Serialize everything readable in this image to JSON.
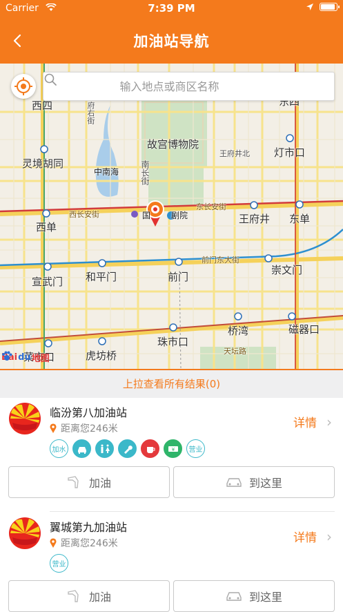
{
  "status": {
    "carrier": "Carrier",
    "time": "7:39 PM"
  },
  "nav": {
    "title": "加油站导航"
  },
  "search": {
    "placeholder": "输入地点或商区名称"
  },
  "map": {
    "labels": {
      "xisi": "西四",
      "fuyoujie": "府右街",
      "gugong": "故宫博物院",
      "dengshikou": "灯市口",
      "lingjing": "灵境胡同",
      "zhongnanhai": "中南海",
      "nanchangjie": "南长街",
      "xichanganjie": "西长安街",
      "dongchanganjie": "东长安街",
      "wangfujing": "王府井",
      "dongdan": "东单",
      "xidan": "西单",
      "guojia": "国",
      "dajuyuan": "剧院",
      "qianmendongdajie": "前门东大街",
      "xuanwumen": "宣武门",
      "hepingmen": "和平门",
      "qianmen": "前门",
      "chongwenmen": "崇文门",
      "qiaowan": "桥湾",
      "zhushikou": "珠市口",
      "cishikou": "磁器口",
      "tiantanlu": "天坛路",
      "hufangqiao": "虎坊桥",
      "caishikou": "菜市口",
      "wangfujingbei": "王府井北",
      "dongsi": "东四"
    },
    "logo": {
      "bai": "Bai",
      "du": "du",
      "map": "地图"
    }
  },
  "pull_bar": {
    "text": "上拉查看所有结果(0)"
  },
  "stations": [
    {
      "name": "临汾第八加油站",
      "distance": "距离您246米",
      "detail": "详情",
      "tags": [
        "加水",
        "洗车",
        "厕所",
        "维修",
        "餐饮",
        "ATM",
        "营业"
      ]
    },
    {
      "name": "翼城第九加油站",
      "distance": "距离您246米",
      "detail": "详情",
      "tags": [
        "营业"
      ]
    }
  ],
  "buttons": {
    "refuel": "加油",
    "go": "到这里"
  },
  "colors": {
    "accent": "#f47a1c",
    "tag": "#3bb8c9"
  }
}
